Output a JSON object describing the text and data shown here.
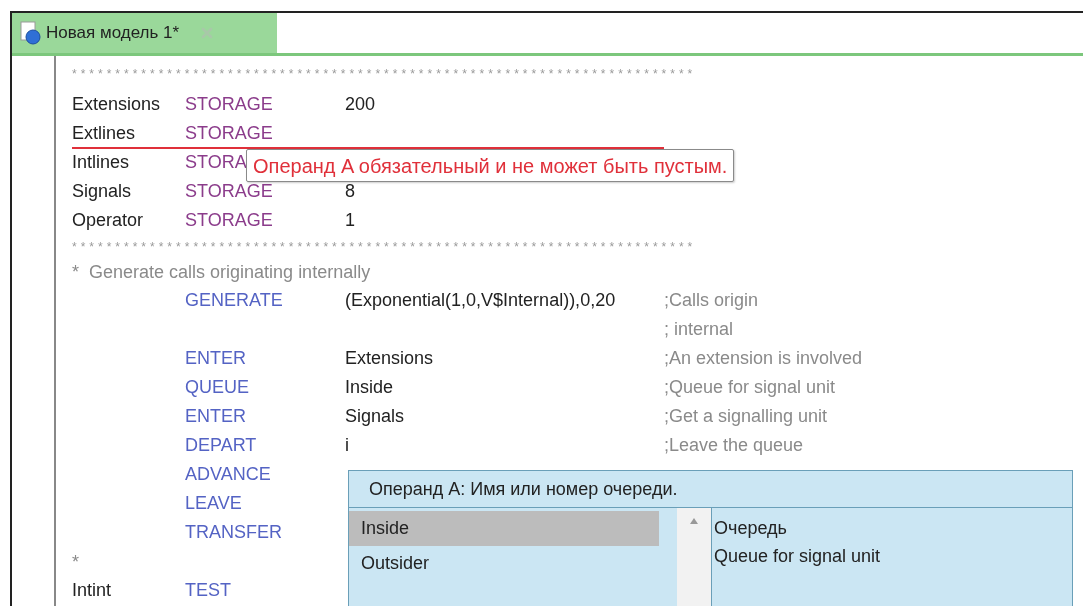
{
  "tab": {
    "title": "Новая модель 1*",
    "selected": true
  },
  "code": [
    {
      "kind": "rule",
      "text": "************************************************************************"
    },
    {
      "kind": "definition",
      "label": "Extensions",
      "opcode": "STORAGE",
      "operand": "200",
      "error": false
    },
    {
      "kind": "definition",
      "label": "Extlines",
      "opcode": "STORAGE",
      "error": true
    },
    {
      "kind": "definition",
      "label": "Intlines",
      "opcode": "STORA",
      "error": false
    },
    {
      "kind": "definition",
      "label": "Signals",
      "opcode": "STORAGE",
      "operand": "8",
      "error": false
    },
    {
      "kind": "definition",
      "label": "Operator",
      "opcode": "STORAGE",
      "operand": "1",
      "error": false
    },
    {
      "kind": "rule",
      "text": "************************************************************************"
    },
    {
      "kind": "comment",
      "text": "*  Generate calls originating internally"
    },
    {
      "kind": "block",
      "opcode": "GENERATE",
      "operand": "(Exponential(1,0,V$Internal)),0,20",
      "comment": ";Calls origin",
      "error": false
    },
    {
      "kind": "block",
      "comment": "; internal",
      "error": false
    },
    {
      "kind": "block",
      "opcode": "ENTER",
      "operand": "Extensions",
      "comment": ";An extension is involved",
      "error": false
    },
    {
      "kind": "block",
      "opcode": "QUEUE",
      "operand": "Inside",
      "comment": ";Queue for signal unit",
      "error": false
    },
    {
      "kind": "block",
      "opcode": "ENTER",
      "operand": "Signals",
      "comment": ";Get a signalling unit",
      "error": false
    },
    {
      "kind": "block",
      "opcode": "DEPART",
      "operand": "i",
      "comment": ";Leave the queue",
      "error": false
    },
    {
      "kind": "block",
      "opcode": "ADVANCE",
      "error": false
    },
    {
      "kind": "block",
      "opcode": "LEAVE",
      "error": false
    },
    {
      "kind": "block",
      "opcode": "TRANSFER",
      "error": false
    },
    {
      "kind": "comment",
      "text": "*"
    },
    {
      "kind": "block",
      "label": "Intint",
      "opcode": "TEST",
      "error": false
    }
  ],
  "error_tooltip": {
    "message": "Операнд A обязательный и не может быть пустым."
  },
  "completion_popup": {
    "title": "Операнд A: Имя или номер очереди.",
    "items": [
      {
        "label": "Inside",
        "selected": true
      },
      {
        "label": "Outsider",
        "selected": false
      }
    ],
    "description": [
      "Очередь",
      "Queue for signal unit"
    ]
  }
}
